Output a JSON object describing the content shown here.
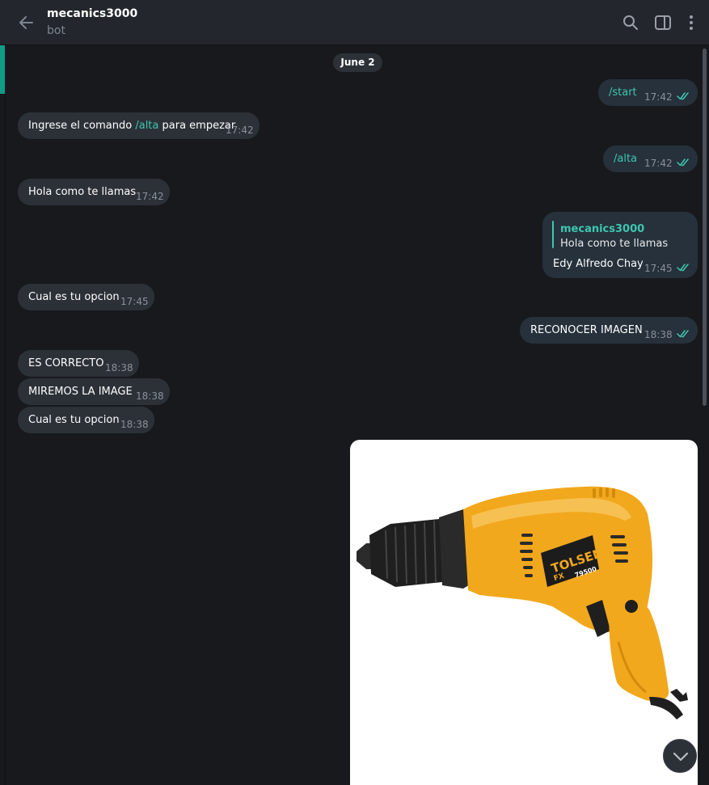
{
  "header": {
    "title": "mecanics3000",
    "subtitle": "bot",
    "icons": [
      "back-arrow-icon",
      "search-icon",
      "sidebar-toggle-icon",
      "more-vertical-icon"
    ]
  },
  "date_divider": "June 2",
  "messages": [
    {
      "dir": "out",
      "text": "/start",
      "time": "17:42"
    },
    {
      "dir": "in",
      "text_before": "Ingrese el comando ",
      "command": "/alta",
      "text_after": " para empezar",
      "time": "17:42"
    },
    {
      "dir": "out",
      "text": "/alta",
      "time": "17:42"
    },
    {
      "dir": "in",
      "text": "Hola como te llamas",
      "time": "17:42"
    },
    {
      "dir": "out",
      "reply_to": {
        "name": "mecanics3000",
        "text": "Hola como te llamas"
      },
      "text": "Edy Alfredo Chay",
      "time": "17:45"
    },
    {
      "dir": "in",
      "text": "Cual es tu opcion",
      "time": "17:45"
    },
    {
      "dir": "out",
      "text": "RECONOCER IMAGEN",
      "time": "18:38"
    },
    {
      "dir": "in",
      "text": "ES CORRECTO",
      "time": "18:38"
    },
    {
      "dir": "in",
      "text": "MIREMOS LA IMAGE",
      "time": "18:38"
    },
    {
      "dir": "in",
      "text": "Cual es tu opcion",
      "time": "18:38"
    }
  ],
  "photo": {
    "brand": "TOLSEN",
    "model": "79500",
    "badge": "FX"
  },
  "colors": {
    "accent": "#3ec6b0",
    "drill_body": "#f2a81d",
    "background": "#17191d"
  }
}
